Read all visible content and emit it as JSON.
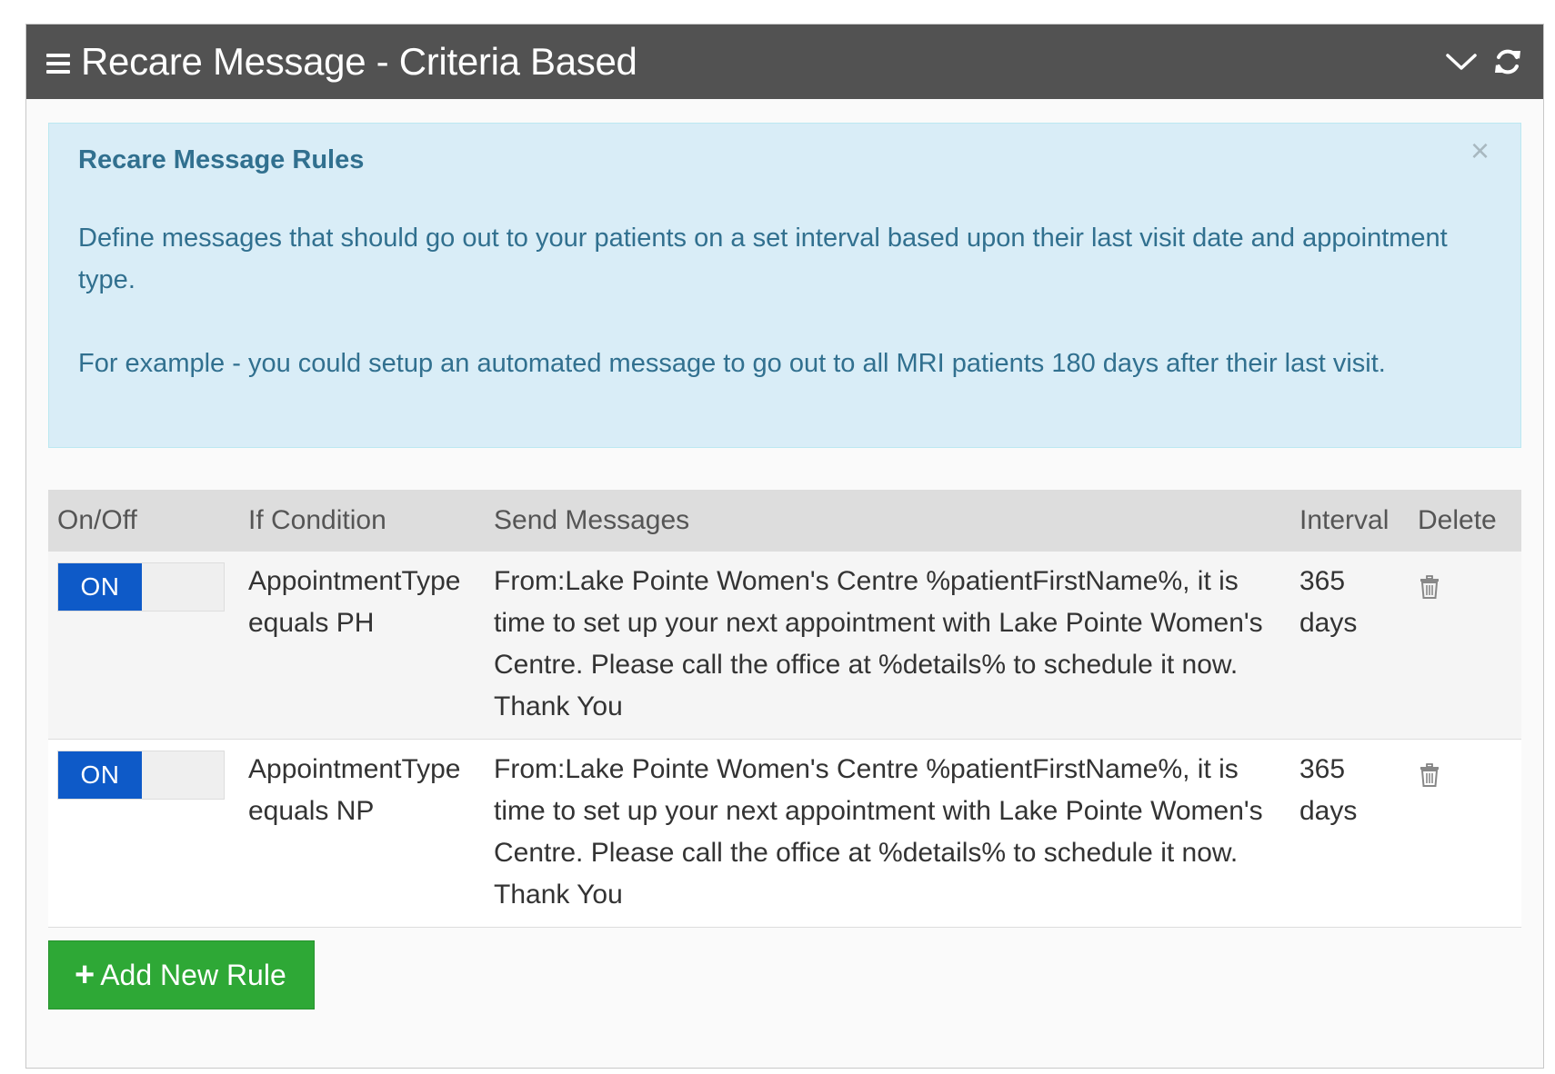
{
  "panel": {
    "title": "Recare Message - Criteria Based"
  },
  "alert": {
    "title": "Recare Message Rules",
    "paragraph1": "Define messages that should go out to your patients on a set interval based upon their last visit date and appointment type.",
    "paragraph2": "For example - you could setup an automated message to go out to all MRI patients 180 days after their last visit.",
    "close_symbol": "×"
  },
  "table": {
    "headers": {
      "onoff": "On/Off",
      "condition": "If Condition",
      "message": "Send Messages",
      "interval": "Interval",
      "delete": "Delete"
    },
    "rows": [
      {
        "toggle": "ON",
        "condition": "AppointmentType equals PH",
        "message": "From:Lake Pointe Women's Centre %patientFirstName%, it is time to set up your next appointment with Lake Pointe Women's Centre. Please call the office at %details% to schedule it now. Thank You",
        "interval_value": "365",
        "interval_unit": "days"
      },
      {
        "toggle": "ON",
        "condition": "AppointmentType equals NP",
        "message": "From:Lake Pointe Women's Centre %patientFirstName%, it is time to set up your next appointment with Lake Pointe Women's Centre. Please call the office at %details% to schedule it now. Thank You",
        "interval_value": "365",
        "interval_unit": "days"
      }
    ]
  },
  "add_button": {
    "label": "Add New Rule"
  },
  "icons": {
    "menu": "hamburger-icon",
    "collapse": "chevron-down-icon",
    "refresh": "refresh-icon",
    "delete": "trash-icon",
    "add": "plus-icon"
  },
  "colors": {
    "header_bg": "#525252",
    "alert_bg": "#d9edf7",
    "alert_text": "#31708f",
    "toggle_on": "#0e5ac8",
    "add_button": "#2ea836"
  }
}
